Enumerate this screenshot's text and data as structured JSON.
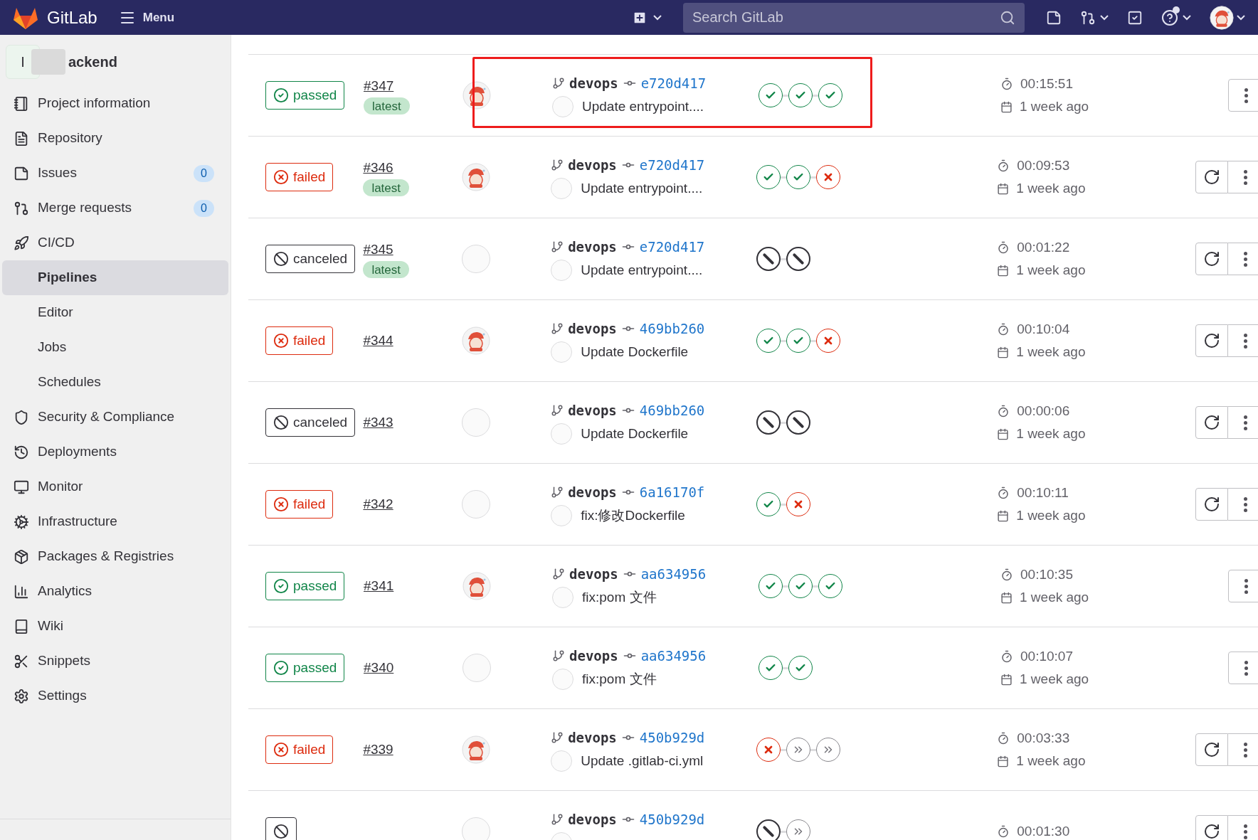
{
  "header": {
    "brand": "GitLab",
    "menu": "Menu",
    "search": {
      "placeholder": "Search GitLab"
    },
    "help_notification": true
  },
  "sidebar": {
    "project": {
      "letter": "I",
      "name": "ackend"
    },
    "items": [
      {
        "label": "Project information",
        "selected": false
      },
      {
        "label": "Repository",
        "selected": false
      },
      {
        "label": "Issues",
        "count": "0",
        "selected": false
      },
      {
        "label": "Merge requests",
        "count": "0",
        "selected": false
      },
      {
        "label": "CI/CD",
        "selected": false,
        "children": [
          {
            "label": "Pipelines",
            "selected": true
          },
          {
            "label": "Editor",
            "selected": false
          },
          {
            "label": "Jobs",
            "selected": false
          },
          {
            "label": "Schedules",
            "selected": false
          }
        ]
      },
      {
        "label": "Security & Compliance",
        "selected": false
      },
      {
        "label": "Deployments",
        "selected": false
      },
      {
        "label": "Monitor",
        "selected": false
      },
      {
        "label": "Infrastructure",
        "selected": false
      },
      {
        "label": "Packages & Registries",
        "selected": false
      },
      {
        "label": "Analytics",
        "selected": false
      },
      {
        "label": "Wiki",
        "selected": false
      },
      {
        "label": "Snippets",
        "selected": false
      },
      {
        "label": "Settings",
        "selected": false
      }
    ]
  },
  "pipelines": [
    {
      "kind": "passed",
      "label": "passed",
      "id": "#347",
      "tag": "latest",
      "author_avatar": true,
      "branch": "devops",
      "sha": "e720d417",
      "message": "Update entrypoint....",
      "stages": [
        {
          "kind": "success"
        },
        {
          "kind": "success"
        },
        {
          "kind": "success"
        }
      ],
      "duration": "00:15:51",
      "finished": "1 week ago",
      "retry": false,
      "highlighted": true
    },
    {
      "kind": "failed",
      "label": "failed",
      "id": "#346",
      "tag": "latest",
      "author_avatar": true,
      "branch": "devops",
      "sha": "e720d417",
      "message": "Update entrypoint....",
      "stages": [
        {
          "kind": "success"
        },
        {
          "kind": "success"
        },
        {
          "kind": "failed"
        }
      ],
      "duration": "00:09:53",
      "finished": "1 week ago",
      "retry": true,
      "highlighted": false
    },
    {
      "kind": "canceled",
      "label": "canceled",
      "id": "#345",
      "tag": "latest",
      "author_avatar": false,
      "branch": "devops",
      "sha": "e720d417",
      "message": "Update entrypoint....",
      "stages": [
        {
          "kind": "canceled"
        },
        {
          "kind": "canceled"
        }
      ],
      "duration": "00:01:22",
      "finished": "1 week ago",
      "retry": true,
      "highlighted": false
    },
    {
      "kind": "failed",
      "label": "failed",
      "id": "#344",
      "author_avatar": true,
      "branch": "devops",
      "sha": "469bb260",
      "message": "Update Dockerfile",
      "stages": [
        {
          "kind": "success"
        },
        {
          "kind": "success"
        },
        {
          "kind": "failed"
        }
      ],
      "duration": "00:10:04",
      "finished": "1 week ago",
      "retry": true,
      "highlighted": false
    },
    {
      "kind": "canceled",
      "label": "canceled",
      "id": "#343",
      "author_avatar": false,
      "branch": "devops",
      "sha": "469bb260",
      "message": "Update Dockerfile",
      "stages": [
        {
          "kind": "canceled"
        },
        {
          "kind": "canceled"
        }
      ],
      "duration": "00:00:06",
      "finished": "1 week ago",
      "retry": true,
      "highlighted": false
    },
    {
      "kind": "failed",
      "label": "failed",
      "id": "#342",
      "author_avatar": false,
      "branch": "devops",
      "sha": "6a16170f",
      "message": "fix:修改Dockerfile",
      "stages": [
        {
          "kind": "success"
        },
        {
          "kind": "failed"
        }
      ],
      "duration": "00:10:11",
      "finished": "1 week ago",
      "retry": true,
      "highlighted": false
    },
    {
      "kind": "passed",
      "label": "passed",
      "id": "#341",
      "author_avatar": true,
      "branch": "devops",
      "sha": "aa634956",
      "message": "fix:pom 文件",
      "stages": [
        {
          "kind": "success"
        },
        {
          "kind": "success"
        },
        {
          "kind": "success"
        }
      ],
      "duration": "00:10:35",
      "finished": "1 week ago",
      "retry": false,
      "highlighted": false
    },
    {
      "kind": "passed",
      "label": "passed",
      "id": "#340",
      "author_avatar": false,
      "branch": "devops",
      "sha": "aa634956",
      "message": "fix:pom 文件",
      "stages": [
        {
          "kind": "success"
        },
        {
          "kind": "success"
        }
      ],
      "duration": "00:10:07",
      "finished": "1 week ago",
      "retry": false,
      "highlighted": false
    },
    {
      "kind": "failed",
      "label": "failed",
      "id": "#339",
      "author_avatar": true,
      "branch": "devops",
      "sha": "450b929d",
      "message": "Update .gitlab-ci.yml",
      "stages": [
        {
          "kind": "failed"
        },
        {
          "kind": "skipped"
        },
        {
          "kind": "skipped"
        }
      ],
      "duration": "00:03:33",
      "finished": "1 week ago",
      "retry": true,
      "highlighted": false
    },
    {
      "kind": "canceled",
      "author_avatar": false,
      "branch": "devops",
      "sha": "450b929d",
      "stages": [
        {
          "kind": "canceled"
        },
        {
          "kind": "skipped"
        }
      ],
      "duration": "00:01:30",
      "retry": true,
      "highlighted": false
    }
  ]
}
